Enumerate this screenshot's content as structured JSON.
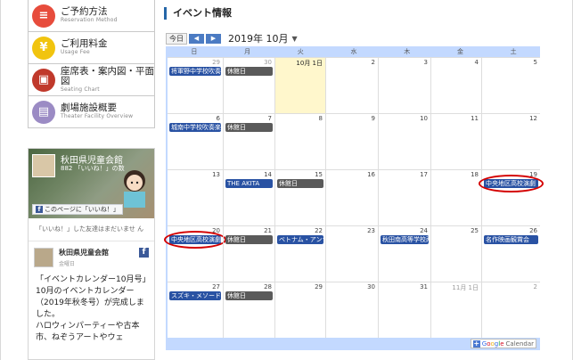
{
  "sidebar": {
    "menu": [
      {
        "title": "ご予約方法",
        "sub": "Reservation Method",
        "icon": "calendar-icon",
        "color": "#e74c3c",
        "glyph": "≡"
      },
      {
        "title": "ご利用料金",
        "sub": "Usage Fee",
        "icon": "yen-icon",
        "color": "#f1c40f",
        "glyph": "¥"
      },
      {
        "title": "座席表・案内図・平面図",
        "sub": "Seating Chart",
        "icon": "seat-icon",
        "color": "#c0392b",
        "glyph": "▣"
      },
      {
        "title": "劇場施設概要",
        "sub": "Theater Facility Overview",
        "icon": "book-icon",
        "color": "#9b8bc4",
        "glyph": "▤"
      }
    ],
    "facebook": {
      "page_name": "秋田県児童会館",
      "likes": "882 「いいね！」の数",
      "like_button": "このページに「いいね！」",
      "friends_note": "「いいね！」した友達はまだいませ ん",
      "post_author": "秋田県児童会館",
      "post_date": "金曜日",
      "post_body": "「イベントカレンダー10月号」\n10月のイベントカレンダー（2019年秋冬号）が完成しました。\nハロウィンパーティーや古本市、ねぞうアートやウェ"
    }
  },
  "main": {
    "title": "イベント情報",
    "toolbar": {
      "today": "今日",
      "prev": "◀",
      "next": "▶",
      "month": "2019年 10月",
      "caret": "▼"
    },
    "days_of_week": [
      "日",
      "月",
      "火",
      "水",
      "木",
      "金",
      "土"
    ],
    "weeks": [
      [
        {
          "date": "29",
          "other": true,
          "event": {
            "text": "将軍野中学校吹奏",
            "style": "blue"
          }
        },
        {
          "date": "30",
          "other": true,
          "event": {
            "text": "休館日",
            "style": "gray"
          }
        },
        {
          "date": "10月 1日",
          "today": true
        },
        {
          "date": "2"
        },
        {
          "date": "3"
        },
        {
          "date": "4"
        },
        {
          "date": "5"
        }
      ],
      [
        {
          "date": "6",
          "event": {
            "text": "城南中学校吹奏楽",
            "style": "blue"
          }
        },
        {
          "date": "7",
          "event": {
            "text": "休館日",
            "style": "gray"
          }
        },
        {
          "date": "8"
        },
        {
          "date": "9"
        },
        {
          "date": "10"
        },
        {
          "date": "11"
        },
        {
          "date": "12"
        }
      ],
      [
        {
          "date": "13"
        },
        {
          "date": "14",
          "event": {
            "text": "THE AKITA",
            "style": "blue"
          }
        },
        {
          "date": "15",
          "event": {
            "text": "休館日",
            "style": "gray"
          }
        },
        {
          "date": "16"
        },
        {
          "date": "17"
        },
        {
          "date": "18"
        },
        {
          "date": "19",
          "event": {
            "text": "中央地区高校演劇",
            "style": "blue",
            "ring": true
          }
        }
      ],
      [
        {
          "date": "20",
          "event": {
            "text": "中央地区高校演劇",
            "style": "blue",
            "ring": true
          }
        },
        {
          "date": "21",
          "event": {
            "text": "休館日",
            "style": "gray"
          }
        },
        {
          "date": "22",
          "event": {
            "text": "ベトナム・アンサ",
            "style": "blue"
          }
        },
        {
          "date": "23"
        },
        {
          "date": "24",
          "event": {
            "text": "秋田南高等学校两",
            "style": "blue"
          }
        },
        {
          "date": "25"
        },
        {
          "date": "26",
          "event": {
            "text": "名作映画観賞会",
            "style": "blue"
          }
        }
      ],
      [
        {
          "date": "27",
          "event": {
            "text": "スズキ・メソード",
            "style": "blue"
          }
        },
        {
          "date": "28",
          "event": {
            "text": "休館日",
            "style": "gray"
          }
        },
        {
          "date": "29"
        },
        {
          "date": "30"
        },
        {
          "date": "31"
        },
        {
          "date": "11月 1日",
          "other": true
        },
        {
          "date": "2",
          "other": true
        }
      ]
    ],
    "google_badge": {
      "plus": "+",
      "g": "G",
      "o1": "o",
      "o2": "o",
      "gl": "g",
      "l": "l",
      "e": "e",
      "cal": "Calendar"
    }
  }
}
